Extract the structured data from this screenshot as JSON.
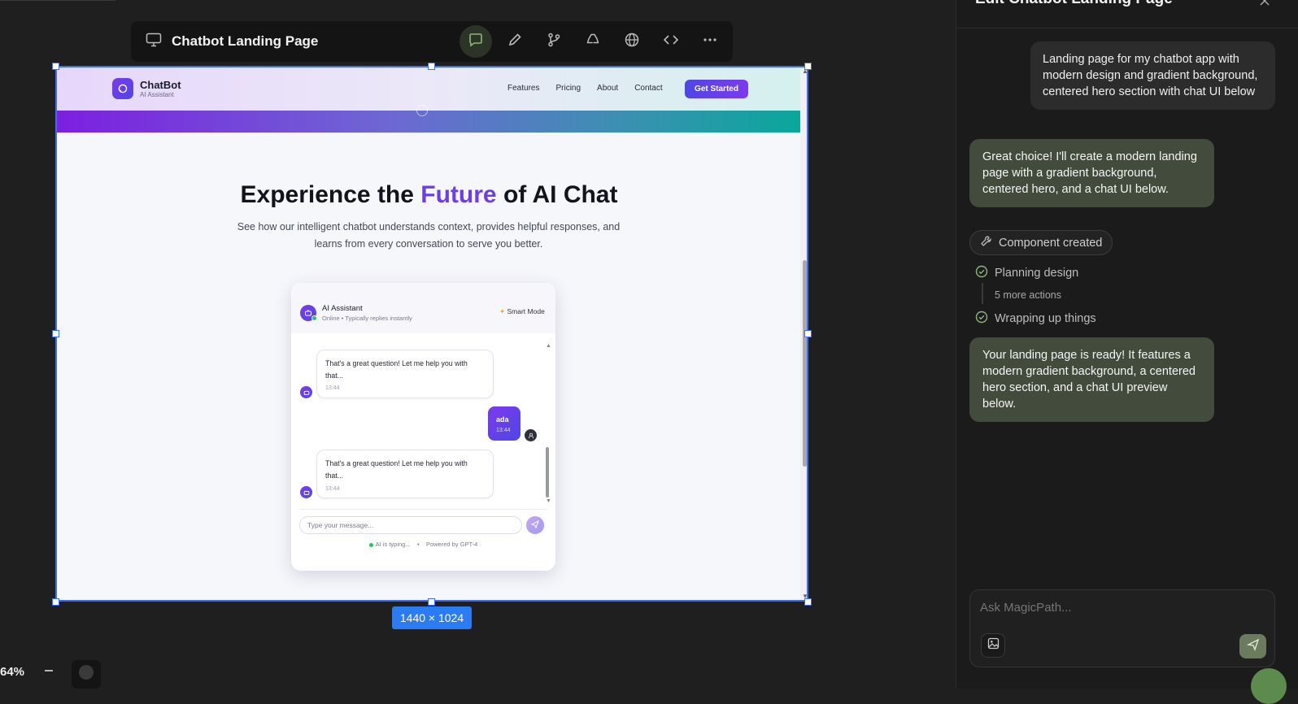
{
  "toolbar": {
    "title": "Chatbot Landing Page"
  },
  "canvas": {
    "size_label": "1440 × 1024",
    "zoom_label": "64%"
  },
  "site": {
    "brand_name": "ChatBot",
    "brand_sub": "AI Assistant",
    "nav": [
      "Features",
      "Pricing",
      "About",
      "Contact"
    ],
    "cta": "Get Started",
    "hero_title_a": "Experience the ",
    "hero_title_accent": "Future",
    "hero_title_b": " of AI Chat",
    "hero_sub": "See how our intelligent chatbot understands context, provides helpful responses, and learns from every conversation to serve you better."
  },
  "chat": {
    "title": "AI Assistant",
    "status": "Online • Typically replies instantly",
    "smart_mode": "Smart Mode",
    "messages": [
      {
        "from": "bot",
        "text": "That's a great question! Let me help you with that...",
        "time": "13:44"
      },
      {
        "from": "user",
        "text": "ada",
        "time": "13:44"
      },
      {
        "from": "bot",
        "text": "That's a great question! Let me help you with that...",
        "time": "13:44"
      }
    ],
    "placeholder": "Type your message...",
    "typing": "AI is typing...",
    "separator": "•",
    "powered": "Powered by GPT-4"
  },
  "panel": {
    "title": "Edit Chatbot Landing Page",
    "user_prompt": "Landing page for my chatbot app with modern design and gradient background, centered hero section with chat UI below",
    "ai_reply_1": "Great choice! I'll create a modern landing page with a gradient background, centered hero, and a chat UI below.",
    "chip": "Component created",
    "step_1": "Planning design",
    "more_actions": "5 more actions",
    "step_2": "Wrapping up things",
    "ai_reply_2": "Your landing page is ready! It features a modern gradient background, a centered hero section, and a chat UI preview below.",
    "composer_placeholder": "Ask MagicPath..."
  },
  "colors": {
    "accent": "#3b6ef5",
    "brand_purple": "#6d3ee8",
    "ai_bubble": "#434b3c",
    "send_button": "#6b7c5e"
  },
  "icons": [
    "monitor-icon",
    "chat-icon",
    "pencil-icon",
    "branch-icon",
    "recycle-icon",
    "globe-icon",
    "code-icon",
    "more-icon",
    "wrench-icon",
    "check-circle-icon",
    "image-icon",
    "send-icon",
    "close-icon",
    "robot-icon",
    "sparkle-icon",
    "user-icon"
  ]
}
